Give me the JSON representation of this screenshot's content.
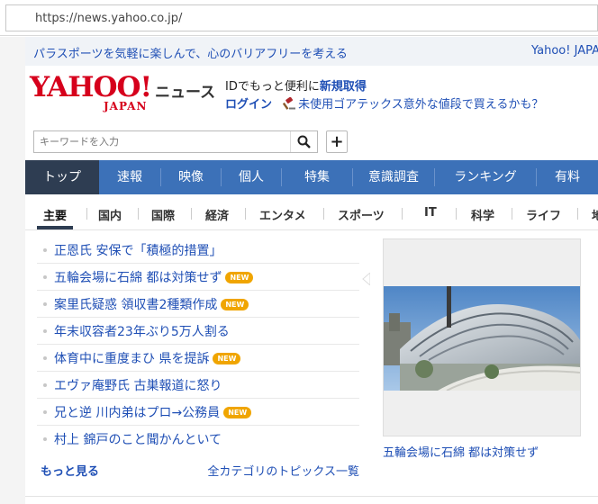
{
  "browser": {
    "url": "https://news.yahoo.co.jp/"
  },
  "promo": {
    "text": "パラスポーツを気軽に楽しんで、心のバリアフリーを考える",
    "right": "Yahoo! JAPAN"
  },
  "header": {
    "logo_main": "YAHOO!",
    "logo_sub": "JAPAN",
    "service_name": "ニュース",
    "id_prefix": "IDでもっと便利に",
    "register_label": "新規取得",
    "login_label": "ログイン",
    "ad_text": "未使用ゴアテックス意外な値段で買えるかも？"
  },
  "search": {
    "placeholder": "キーワードを入力",
    "icon": "search-icon",
    "add_label": "+"
  },
  "main_nav": [
    "トップ",
    "速報",
    "映像",
    "個人",
    "特集",
    "意識調査",
    "ランキング",
    "有料"
  ],
  "categories": [
    "主要",
    "国内",
    "国際",
    "経済",
    "エンタメ",
    "スポーツ",
    "IT",
    "科学",
    "ライフ",
    "地域"
  ],
  "topics": [
    {
      "title": "正恩氏 安保で「積極的措置」",
      "new": false
    },
    {
      "title": "五輪会場に石綿 都は対策せず",
      "new": true
    },
    {
      "title": "案里氏疑惑 領収書2種類作成",
      "new": true
    },
    {
      "title": "年末収容者23年ぶり5万人割る",
      "new": false
    },
    {
      "title": "体育中に重度まひ 県を提訴",
      "new": true
    },
    {
      "title": "エヴァ庵野氏 古巣報道に怒り",
      "new": false
    },
    {
      "title": "兄と逆 川内弟はプロ→公務員",
      "new": true
    },
    {
      "title": "村上 錦戸のこと聞かんといて",
      "new": false
    }
  ],
  "new_badge": "NEW",
  "more_label": "もっと見る",
  "all_categories_label": "全カテゴリのトピックス一覧",
  "photo_caption": "五輪会場に石綿 都は対策せず",
  "colors": {
    "brand_red": "#d6001c",
    "nav_blue": "#3c71b8",
    "nav_active": "#2e3d52",
    "link": "#1f4fb5",
    "badge": "#f0a500"
  }
}
